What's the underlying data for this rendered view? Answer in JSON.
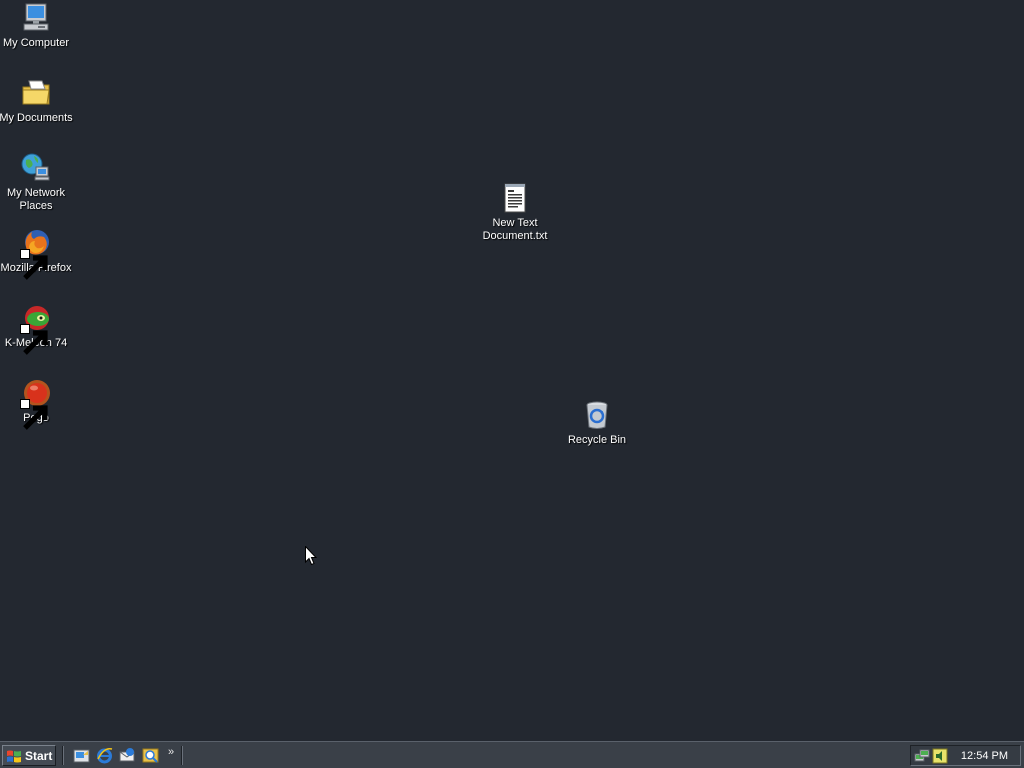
{
  "desktop": {
    "background": "#232830",
    "icons": [
      {
        "label": "My Computer",
        "icon": "computer-icon"
      },
      {
        "label": "My Documents",
        "icon": "documents-folder-icon"
      },
      {
        "label": "My Network Places",
        "icon": "network-places-icon"
      },
      {
        "label": "Mozilla Firefox",
        "icon": "firefox-icon",
        "shortcut": true
      },
      {
        "label": "K-Meleon 74",
        "icon": "kmeleon-icon",
        "shortcut": true
      },
      {
        "label": "Pego",
        "icon": "pego-icon",
        "shortcut": true
      },
      {
        "label": "New Text Document.txt",
        "icon": "text-document-icon"
      },
      {
        "label": "Recycle Bin",
        "icon": "recycle-bin-icon"
      }
    ]
  },
  "taskbar": {
    "start_label": "Start",
    "quick_launch": [
      "show-desktop-icon",
      "internet-explorer-icon",
      "outlook-express-icon",
      "windows-media-icon"
    ],
    "overflow_label": "»",
    "tray_icons": [
      "network-tray-icon",
      "volume-tray-icon"
    ],
    "clock": "12:54 PM"
  }
}
